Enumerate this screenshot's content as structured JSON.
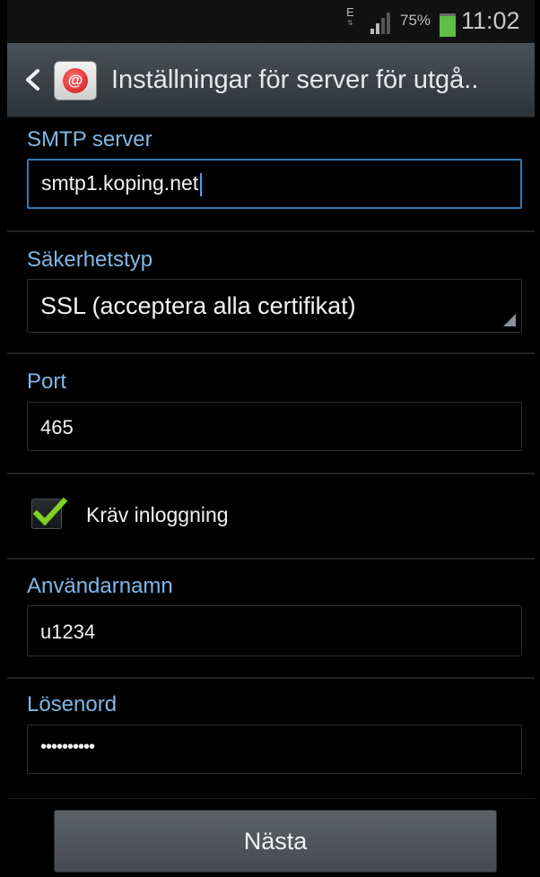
{
  "status_bar": {
    "network_type": "E",
    "battery_percent": "75%",
    "time": "11:02",
    "battery_color": "#5cc043"
  },
  "action_bar": {
    "title": "Inställningar för server för utgå..",
    "back_icon": "chevron-left-icon",
    "app_icon": "email-app-icon"
  },
  "form": {
    "smtp": {
      "label": "SMTP server",
      "value": "smtp1.koping.net"
    },
    "security": {
      "label": "Säkerhetstyp",
      "value": "SSL (acceptera alla certifikat)"
    },
    "port": {
      "label": "Port",
      "value": "465"
    },
    "require_login": {
      "label": "Kräv inloggning",
      "checked": true
    },
    "username": {
      "label": "Användarnamn",
      "value": "u1234"
    },
    "password": {
      "label": "Lösenord",
      "value": "••••••••••"
    }
  },
  "footer": {
    "next_label": "Nästa"
  },
  "colors": {
    "accent": "#7fb8e6",
    "focus_border": "#2f7ab8",
    "check": "#7ed321"
  }
}
